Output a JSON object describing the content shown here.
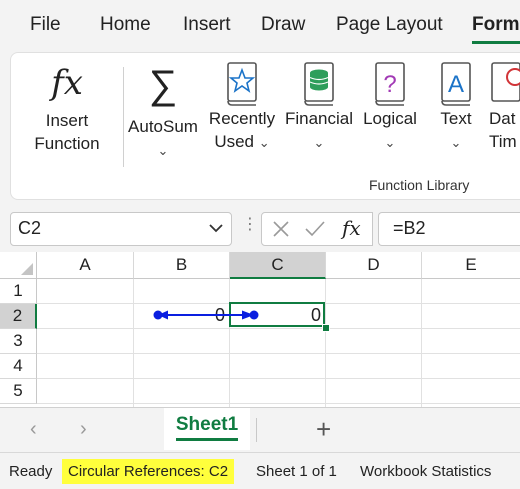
{
  "menu": {
    "tabs": [
      "File",
      "Home",
      "Insert",
      "Draw",
      "Page Layout",
      "Form"
    ],
    "active_tab": "Form"
  },
  "ribbon": {
    "insert_function": "Insert\nFunction",
    "insert_function_l1": "Insert",
    "insert_function_l2": "Function",
    "fx_glyph": "fx",
    "autosum": "AutoSum",
    "recently_used_l1": "Recently",
    "recently_used_l2": "Used",
    "financial": "Financial",
    "logical": "Logical",
    "logical_glyph": "?",
    "text": "Text",
    "text_glyph": "A",
    "datetime_l1": "Dat",
    "datetime_l2": "Tim",
    "group_label": "Function Library"
  },
  "formula_bar": {
    "name_box": "C2",
    "fx": "fx",
    "formula": "=B2"
  },
  "grid": {
    "columns": [
      "A",
      "B",
      "C",
      "D",
      "E"
    ],
    "selected_column": "C",
    "rows": [
      "1",
      "2",
      "3",
      "4",
      "5"
    ],
    "selected_row": "2",
    "cells": {
      "B2": "0",
      "C2": "0"
    }
  },
  "sheets": {
    "tabs": [
      "Sheet1"
    ],
    "active": "Sheet1",
    "add_label": "+"
  },
  "status_bar": {
    "ready": "Ready",
    "circular": "Circular References: C2",
    "sheet_info": "Sheet 1 of 1",
    "workbook_stats": "Workbook Statistics"
  },
  "colors": {
    "accent": "#107c41",
    "trace_arrow": "#0a1fe0",
    "highlight": "#ffff3c"
  }
}
